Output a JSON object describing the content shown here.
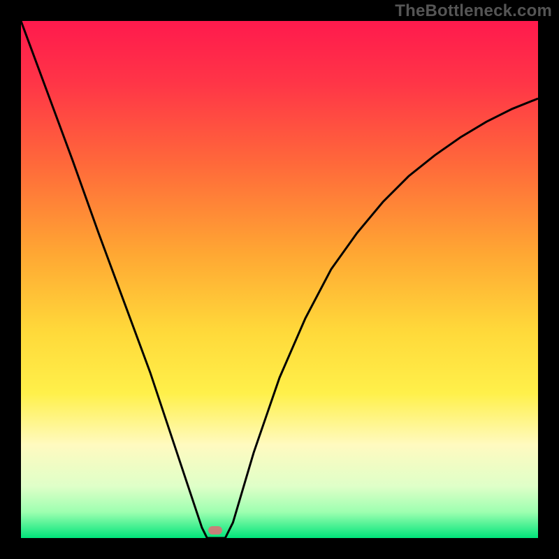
{
  "watermark": "TheBottleneck.com",
  "gradient": {
    "stops": [
      {
        "offset": 0.0,
        "color": "#ff1a4d"
      },
      {
        "offset": 0.12,
        "color": "#ff3547"
      },
      {
        "offset": 0.28,
        "color": "#ff6a3a"
      },
      {
        "offset": 0.45,
        "color": "#ffa733"
      },
      {
        "offset": 0.6,
        "color": "#ffd93a"
      },
      {
        "offset": 0.72,
        "color": "#fff04a"
      },
      {
        "offset": 0.82,
        "color": "#fffac0"
      },
      {
        "offset": 0.9,
        "color": "#dfffc8"
      },
      {
        "offset": 0.95,
        "color": "#9dffb0"
      },
      {
        "offset": 1.0,
        "color": "#00e47a"
      }
    ]
  },
  "curve": {
    "stroke": "#000000",
    "stroke_width": 3
  },
  "marker": {
    "color": "#cf7a78",
    "x_frac": 0.375,
    "y_frac": 0.985
  },
  "chart_data": {
    "type": "line",
    "title": "",
    "xlabel": "",
    "ylabel": "",
    "xlim": [
      0,
      1
    ],
    "ylim": [
      0,
      1
    ],
    "series": [
      {
        "name": "curve",
        "x": [
          0.0,
          0.05,
          0.1,
          0.15,
          0.2,
          0.25,
          0.3,
          0.35,
          0.36,
          0.395,
          0.41,
          0.45,
          0.5,
          0.55,
          0.6,
          0.65,
          0.7,
          0.75,
          0.8,
          0.85,
          0.9,
          0.95,
          1.0
        ],
        "y": [
          1.0,
          0.865,
          0.73,
          0.59,
          0.455,
          0.32,
          0.17,
          0.02,
          0.0,
          0.0,
          0.03,
          0.165,
          0.31,
          0.425,
          0.52,
          0.59,
          0.65,
          0.7,
          0.74,
          0.775,
          0.805,
          0.83,
          0.85
        ]
      }
    ],
    "annotations": [
      {
        "type": "marker",
        "x": 0.375,
        "y": 0.015
      }
    ],
    "legend": false,
    "grid": false
  }
}
